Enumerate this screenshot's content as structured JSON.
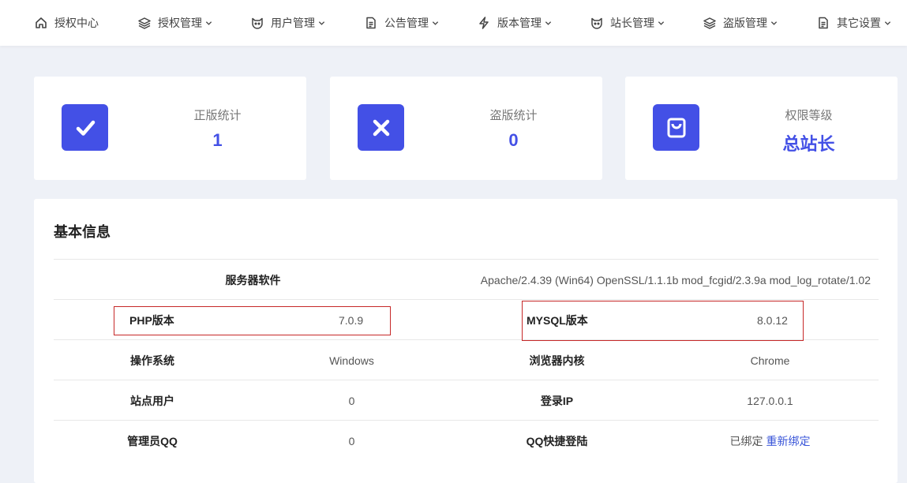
{
  "nav": [
    {
      "label": "授权中心",
      "icon": "home-icon",
      "dropdown": false
    },
    {
      "label": "授权管理",
      "icon": "layers-icon",
      "dropdown": true
    },
    {
      "label": "用户管理",
      "icon": "user-shield-icon",
      "dropdown": true
    },
    {
      "label": "公告管理",
      "icon": "document-icon",
      "dropdown": true
    },
    {
      "label": "版本管理",
      "icon": "lightning-icon",
      "dropdown": true
    },
    {
      "label": "站长管理",
      "icon": "user-shield-icon",
      "dropdown": true
    },
    {
      "label": "盗版管理",
      "icon": "layers-icon",
      "dropdown": true
    },
    {
      "label": "其它设置",
      "icon": "document-icon",
      "dropdown": true
    }
  ],
  "cards": [
    {
      "label": "正版统计",
      "value": "1",
      "icon": "check-icon"
    },
    {
      "label": "盗版统计",
      "value": "0",
      "icon": "close-icon"
    },
    {
      "label": "权限等级",
      "value": "总站长",
      "icon": "shopping-bag-icon"
    }
  ],
  "info": {
    "title": "基本信息",
    "server_software": {
      "key": "服务器软件",
      "value": "Apache/2.4.39 (Win64) OpenSSL/1.1.1b mod_fcgid/2.3.9a mod_log_rotate/1.02"
    },
    "php": {
      "key": "PHP版本",
      "value": "7.0.9"
    },
    "mysql": {
      "key": "MYSQL版本",
      "value": "8.0.12"
    },
    "os": {
      "key": "操作系统",
      "value": "Windows"
    },
    "browser": {
      "key": "浏览器内核",
      "value": "Chrome"
    },
    "site_users": {
      "key": "站点用户",
      "value": "0"
    },
    "login_ip": {
      "key": "登录IP",
      "value": "127.0.0.1"
    },
    "admin_qq": {
      "key": "管理员QQ",
      "value": "0"
    },
    "qq_login": {
      "key": "QQ快捷登陆",
      "value": "已绑定",
      "action": "重新绑定"
    }
  },
  "colors": {
    "accent": "#4350e6",
    "highlight": "#c62828",
    "link": "#3a56d9"
  }
}
